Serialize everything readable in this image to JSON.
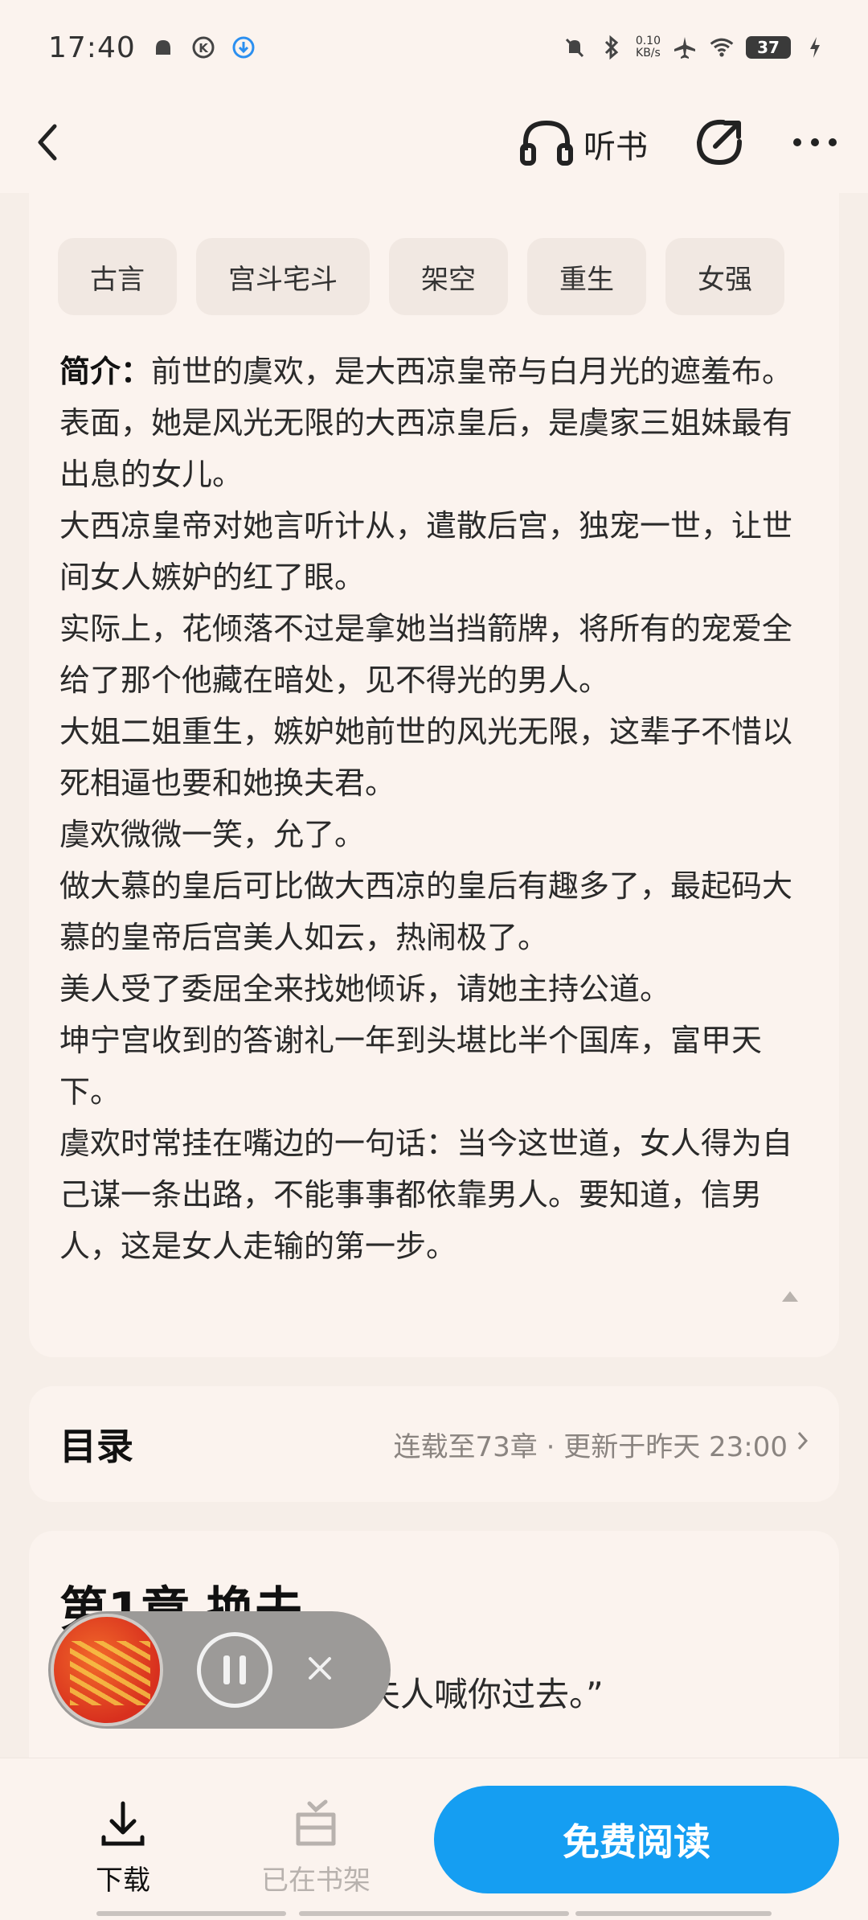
{
  "status": {
    "time": "17:40",
    "net_speed_value": "0.10",
    "net_speed_unit": "KB/s",
    "battery": "37"
  },
  "header": {
    "listen_label": "听书"
  },
  "tags": [
    "古言",
    "宫斗宅斗",
    "架空",
    "重生",
    "女强"
  ],
  "intro": {
    "label": "简介：",
    "first": "前世的虞欢，是大西凉皇帝与白月光的遮羞布。",
    "paragraphs": [
      "表面，她是风光无限的大西凉皇后，是虞家三姐妹最有出息的女儿。",
      "大西凉皇帝对她言听计从，遣散后宫，独宠一世，让世间女人嫉妒的红了眼。",
      "实际上，花倾落不过是拿她当挡箭牌，将所有的宠爱全给了那个他藏在暗处，见不得光的男人。",
      "大姐二姐重生，嫉妒她前世的风光无限，这辈子不惜以死相逼也要和她换夫君。",
      "虞欢微微一笑，允了。",
      "做大慕的皇后可比做大西凉的皇后有趣多了，最起码大慕的皇帝后宫美人如云，热闹极了。",
      "美人受了委屈全来找她倾诉，请她主持公道。",
      "坤宁宫收到的答谢礼一年到头堪比半个国库，富甲天下。",
      "虞欢时常挂在嘴边的一句话：当今这世道，女人得为自己谋一条出路，不能事事都依靠男人。要知道，信男人，这是女人走输的第一步。"
    ]
  },
  "catalog": {
    "title": "目录",
    "meta": "连载至73章 · 更新于昨天 23:00"
  },
  "chapter": {
    "title": "第1章 换夫",
    "line": "夫人喊你过去。”"
  },
  "bottom": {
    "download_label": "下载",
    "shelf_label": "已在书架",
    "read_label": "免费阅读"
  },
  "colors": {
    "accent": "#159ef2",
    "background": "#f6eee8",
    "card": "#fbf3ee"
  }
}
